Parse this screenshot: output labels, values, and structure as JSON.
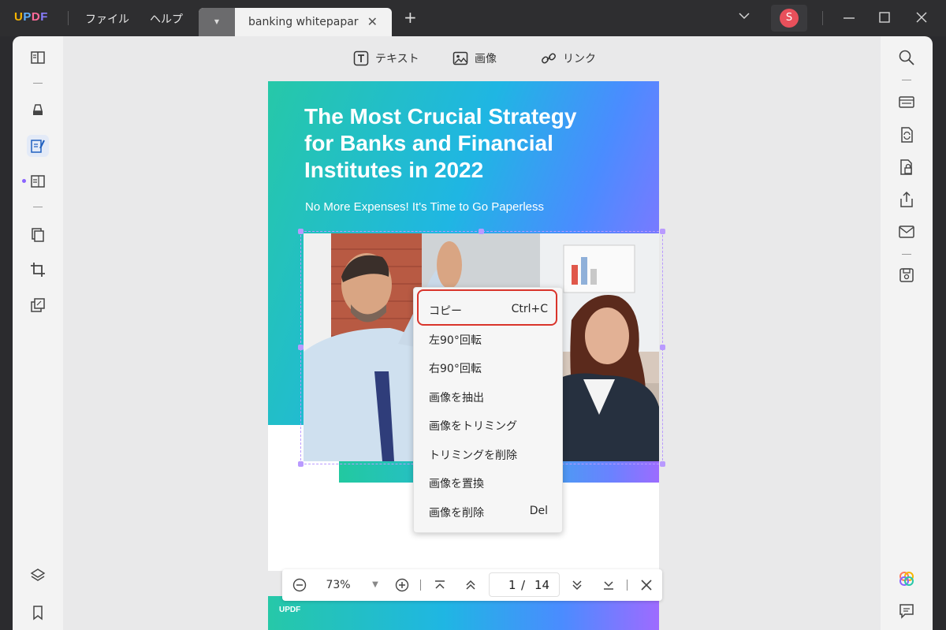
{
  "titlebar": {
    "logo": {
      "u": "U",
      "p": "P",
      "d": "D",
      "f": "F"
    },
    "menu": [
      "ファイル",
      "ヘルプ"
    ],
    "tab": {
      "title": "banking whitepapar"
    },
    "avatar_letter": "S"
  },
  "toolbar": {
    "text_label": "テキスト",
    "image_label": "画像",
    "link_label": "リンク"
  },
  "page": {
    "title": "The Most Crucial Strategy for Banks and Financial Institutes in 2022",
    "subtitle": "No More Expenses! It's Time to Go Paperless"
  },
  "page2": {
    "logo": "UPDF"
  },
  "context_menu": {
    "items": [
      {
        "label": "コピー",
        "shortcut": "Ctrl+C"
      },
      {
        "label": "左90°回転",
        "shortcut": ""
      },
      {
        "label": "右90°回転",
        "shortcut": ""
      },
      {
        "label": "画像を抽出",
        "shortcut": ""
      },
      {
        "label": "画像をトリミング",
        "shortcut": ""
      },
      {
        "label": "トリミングを削除",
        "shortcut": ""
      },
      {
        "label": "画像を置換",
        "shortcut": ""
      },
      {
        "label": "画像を削除",
        "shortcut": "Del"
      }
    ]
  },
  "zoom": {
    "value": "73%",
    "current_page": "1",
    "separator": "/",
    "total_pages": "14"
  },
  "colors": {
    "accent": "#8a63ff",
    "highlight": "#d9342b",
    "selection": "#b99aff"
  }
}
